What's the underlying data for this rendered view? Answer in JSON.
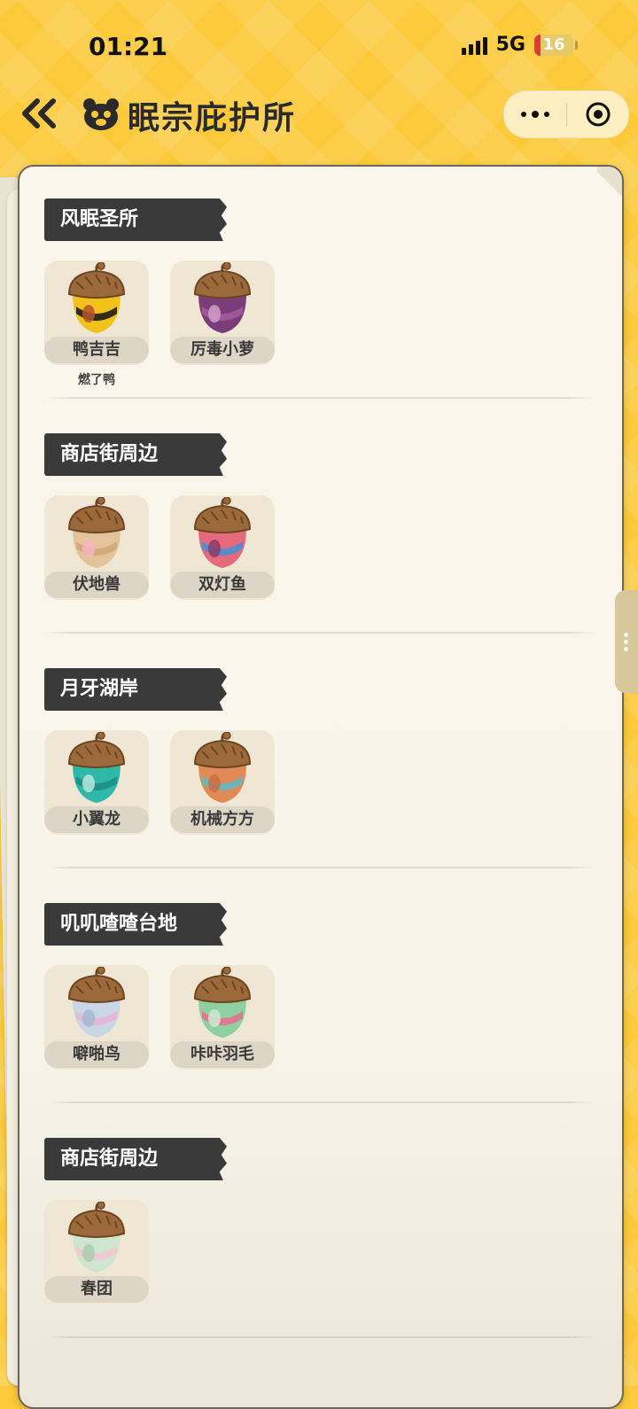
{
  "status_bar": {
    "time": "01:21",
    "network": "5G",
    "battery": "16",
    "battery_level": 0.16
  },
  "header": {
    "title": "眠宗庇护所",
    "back_icon": "double-chevron-left-icon",
    "logo_icon": "bear-face-icon",
    "more_icon": "more-dots-icon",
    "close_icon": "target-circle-icon"
  },
  "colors": {
    "background": "#fbc93a",
    "paper": "#faf6ec",
    "label_bg": "#3a3a3a",
    "card_bg": "#efe6d4"
  },
  "sections": [
    {
      "label": "风眠圣所",
      "items": [
        {
          "name": "鸭吉吉",
          "sub": "燃了鸭",
          "colors": [
            "#f2c21b",
            "#1b1b1b",
            "#b5542b"
          ]
        },
        {
          "name": "厉毒小萝",
          "sub": "",
          "colors": [
            "#7b3d7a",
            "#a25a9b",
            "#cfa0c9"
          ]
        }
      ]
    },
    {
      "label": "商店街周边",
      "items": [
        {
          "name": "伏地兽",
          "sub": "",
          "colors": [
            "#e3c49a",
            "#cfa87a",
            "#f4b5c2"
          ]
        },
        {
          "name": "双灯鱼",
          "sub": "",
          "colors": [
            "#e46a7c",
            "#4a8fd1",
            "#8a3c6c"
          ]
        }
      ]
    },
    {
      "label": "月牙湖岸",
      "items": [
        {
          "name": "小翼龙",
          "sub": "",
          "colors": [
            "#2fb8a8",
            "#1d8e83",
            "#b7e7df"
          ]
        },
        {
          "name": "机械方方",
          "sub": "",
          "colors": [
            "#e08a56",
            "#63b7c6",
            "#c96f3e"
          ]
        }
      ]
    },
    {
      "label": "叽叽喳喳台地",
      "items": [
        {
          "name": "噼啪鸟",
          "sub": "",
          "colors": [
            "#c9d6e6",
            "#e7b6d4",
            "#a4b9d0"
          ]
        },
        {
          "name": "咔咔羽毛",
          "sub": "",
          "colors": [
            "#8fd0a0",
            "#e66f8e",
            "#cfe9d2"
          ]
        }
      ]
    },
    {
      "label": "商店街周边",
      "items": [
        {
          "name": "春团",
          "sub": "",
          "colors": [
            "#cfe5d0",
            "#f2c7d2",
            "#a8cfae"
          ]
        }
      ]
    }
  ]
}
